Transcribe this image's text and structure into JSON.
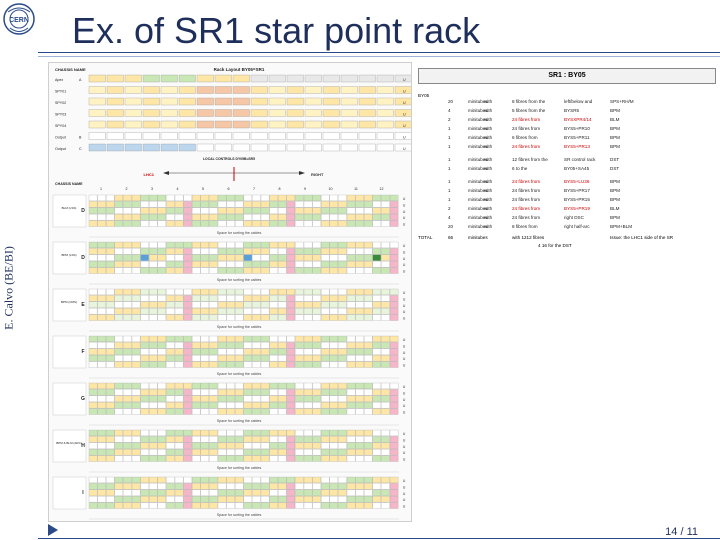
{
  "slide": {
    "title": "Ex. of SR1 star point rack",
    "author": "E. Calvo (BE/BI)",
    "page_number": "14 / 11"
  },
  "rack": {
    "header_label": "CHASSIS NAME",
    "layout_label": "Rack Layout  BY05=SR1",
    "top_rows": [
      {
        "label": "Apex",
        "code": "A"
      },
      {
        "label": "SPY01",
        "code": ""
      },
      {
        "label": "SPY02",
        "code": ""
      },
      {
        "label": "SPY03",
        "code": ""
      },
      {
        "label": "SPY04",
        "code": ""
      },
      {
        "label": "Output",
        "code": "B"
      },
      {
        "label": "Output",
        "code": "C"
      }
    ],
    "controls_label": "LOCAL CONTROLS  DY05B=SR5",
    "lhc_left": "LHC1",
    "lhc_right": "RIGHT",
    "chassis_label": "CHASSIS NAME",
    "col_numbers": [
      "1",
      "2",
      "3",
      "4",
      "5",
      "6",
      "7",
      "8",
      "9",
      "10",
      "11",
      "12"
    ],
    "sections": [
      {
        "letter": "D",
        "side": "BLM (LSS)"
      },
      {
        "letter": "D",
        "side": "BPM (LSS)"
      },
      {
        "letter": "E",
        "side": "BPM (CMS)"
      },
      {
        "letter": "F",
        "side": ""
      },
      {
        "letter": "G",
        "side": ""
      },
      {
        "letter": "H",
        "side": "BPM & BLM (ARC)"
      },
      {
        "letter": "I",
        "side": ""
      }
    ],
    "space_label": "Space for sorting the cables",
    "rack_unit_label": "U"
  },
  "legend": {
    "title": "SR1 : BY05",
    "section_label": "BY05",
    "rows": [
      [
        "20",
        "minitubes",
        "with",
        "8 fibres from the",
        "left/below and",
        "SPS+RH/M"
      ],
      [
        "4",
        "minitubes",
        "with",
        "5 fibres from the",
        "BYSR5",
        "BPM"
      ],
      [
        "2",
        "minitubes",
        "with",
        "24 fibres from",
        "BYSXPR4/14",
        "BLM"
      ],
      [
        "1",
        "minitubes",
        "with",
        "24 fibres from",
        "BYS5+PR10",
        "BPM"
      ],
      [
        "1",
        "minitubes",
        "with",
        "6 fibres from",
        "BYS5+PR11",
        "BPM"
      ],
      [
        "1",
        "minitubes",
        "with",
        "24 fibres from",
        "BYS5+PR13",
        "BPM"
      ],
      [
        "1",
        "minitubes",
        "with",
        "12 fibres from the",
        "SR control rack",
        "DST"
      ],
      [
        "1",
        "minitubes",
        "with",
        "6 to the",
        "BY05+SA45",
        "DST"
      ],
      [
        "1",
        "minitubes",
        "with",
        "24 fibres from",
        "BYS5+LU36",
        "BPM"
      ],
      [
        "1",
        "minitubes",
        "with",
        "24 fibres from",
        "BYS5+PR17",
        "BPM"
      ],
      [
        "1",
        "minitubes",
        "with",
        "24 fibres from",
        "BYS5+PR15",
        "BPM"
      ],
      [
        "2",
        "minitubes",
        "with",
        "24 fibres from",
        "BYS5+PR19",
        "BLM"
      ],
      [
        "4",
        "minitubes",
        "with",
        "24 fibres from",
        "right DSC",
        "BPM"
      ],
      [
        "20",
        "minitubes",
        "with",
        "8 fibres from",
        "right half-arc",
        "BPM+BLM"
      ]
    ],
    "total_label": "TOTAL",
    "total_value": "66",
    "total_suffix": "minitubes",
    "total_fibres": "with   1212 fibres",
    "extra_1": "Issue: the LHC1 side of the SR",
    "extra_2": "4     16     for the DST"
  }
}
